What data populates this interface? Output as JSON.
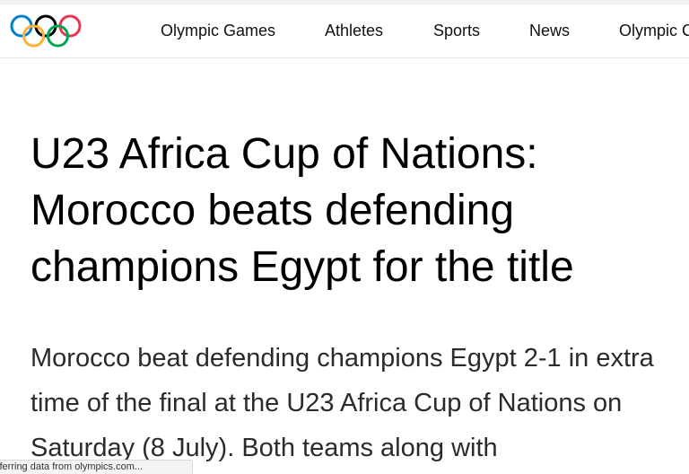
{
  "nav": {
    "items": [
      {
        "label": "Olympic Games"
      },
      {
        "label": "Athletes"
      },
      {
        "label": "Sports"
      },
      {
        "label": "News"
      },
      {
        "label": "Olympic C"
      }
    ]
  },
  "brand": {
    "logo_icon": "olympic-rings-icon",
    "ring_colors": [
      "#0081c8",
      "#fcb131",
      "#000000",
      "#00a651",
      "#ee334e"
    ]
  },
  "article": {
    "title": "U23 Africa Cup of Nations: Morocco beats defending champions Egypt for the title",
    "lede": "Morocco beat defending champions Egypt 2-1 in extra time of the final at the U23 Africa Cup of Nations on Saturday (8 July). Both teams along with"
  },
  "status": {
    "text": "sferring data from olympics.com..."
  }
}
